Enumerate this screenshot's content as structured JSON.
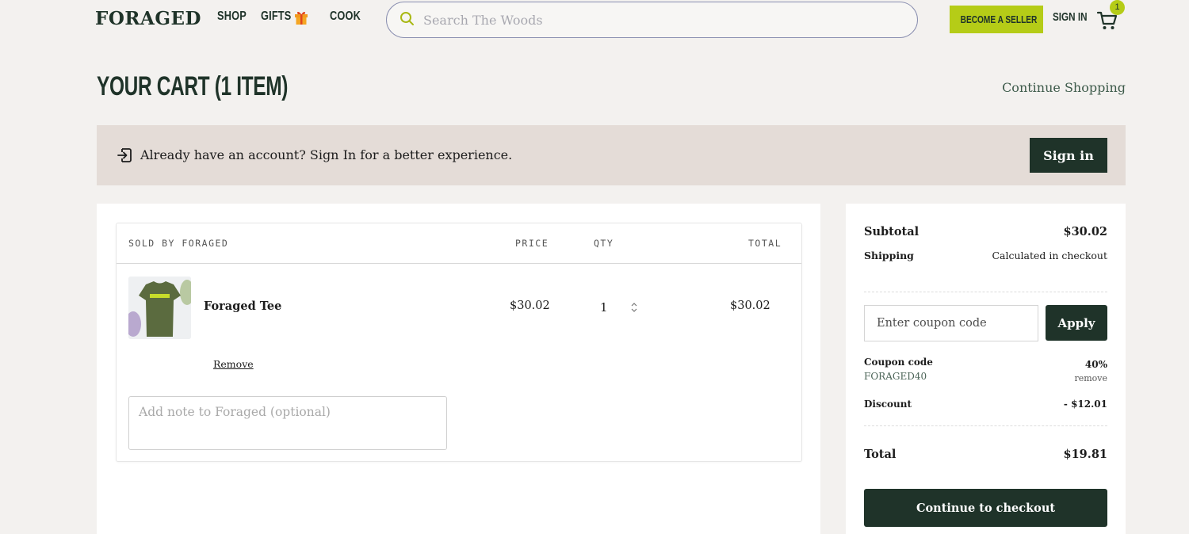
{
  "header": {
    "logo": "FORAGED",
    "nav": {
      "shop": "SHOP",
      "gifts": "GIFTS",
      "cook": "COOK"
    },
    "search_placeholder": "Search The Woods",
    "become_seller": "BECOME A SELLER",
    "sign_in": "SIGN IN",
    "cart_count": "1"
  },
  "page": {
    "title": "YOUR CART (1 ITEM)",
    "continue_shopping": "Continue Shopping"
  },
  "banner": {
    "text": "Already have an account? Sign In for a better experience.",
    "button": "Sign in"
  },
  "cart": {
    "headers": {
      "sold_by": "SOLD BY FORAGED",
      "price": "PRICE",
      "qty": "QTY",
      "total": "TOTAL"
    },
    "items": [
      {
        "name": "Foraged Tee",
        "price": "$30.02",
        "qty": "1",
        "total": "$30.02",
        "remove": "Remove"
      }
    ],
    "note_placeholder": "Add note to Foraged (optional)"
  },
  "summary": {
    "subtotal_label": "Subtotal",
    "subtotal": "$30.02",
    "shipping_label": "Shipping",
    "shipping": "Calculated in checkout",
    "coupon_placeholder": "Enter coupon code",
    "apply": "Apply",
    "coupon_label": "Coupon code",
    "coupon_code": "FORAGED40",
    "coupon_percent": "40%",
    "coupon_remove": "remove",
    "discount_label": "Discount",
    "discount": "- $12.01",
    "total_label": "Total",
    "total": "$19.81",
    "checkout": "Continue to checkout"
  },
  "colors": {
    "brand_dark": "#1f3329",
    "accent_lime": "#b5cc17",
    "banner_bg": "#e4dcd7",
    "page_bg": "#f3f1ef"
  },
  "icons": {
    "search": "search-icon",
    "gift": "gift-icon",
    "cart": "cart-icon",
    "sign_in": "sign-in-icon",
    "qty_arrows": "chevron-up-down-icon"
  }
}
